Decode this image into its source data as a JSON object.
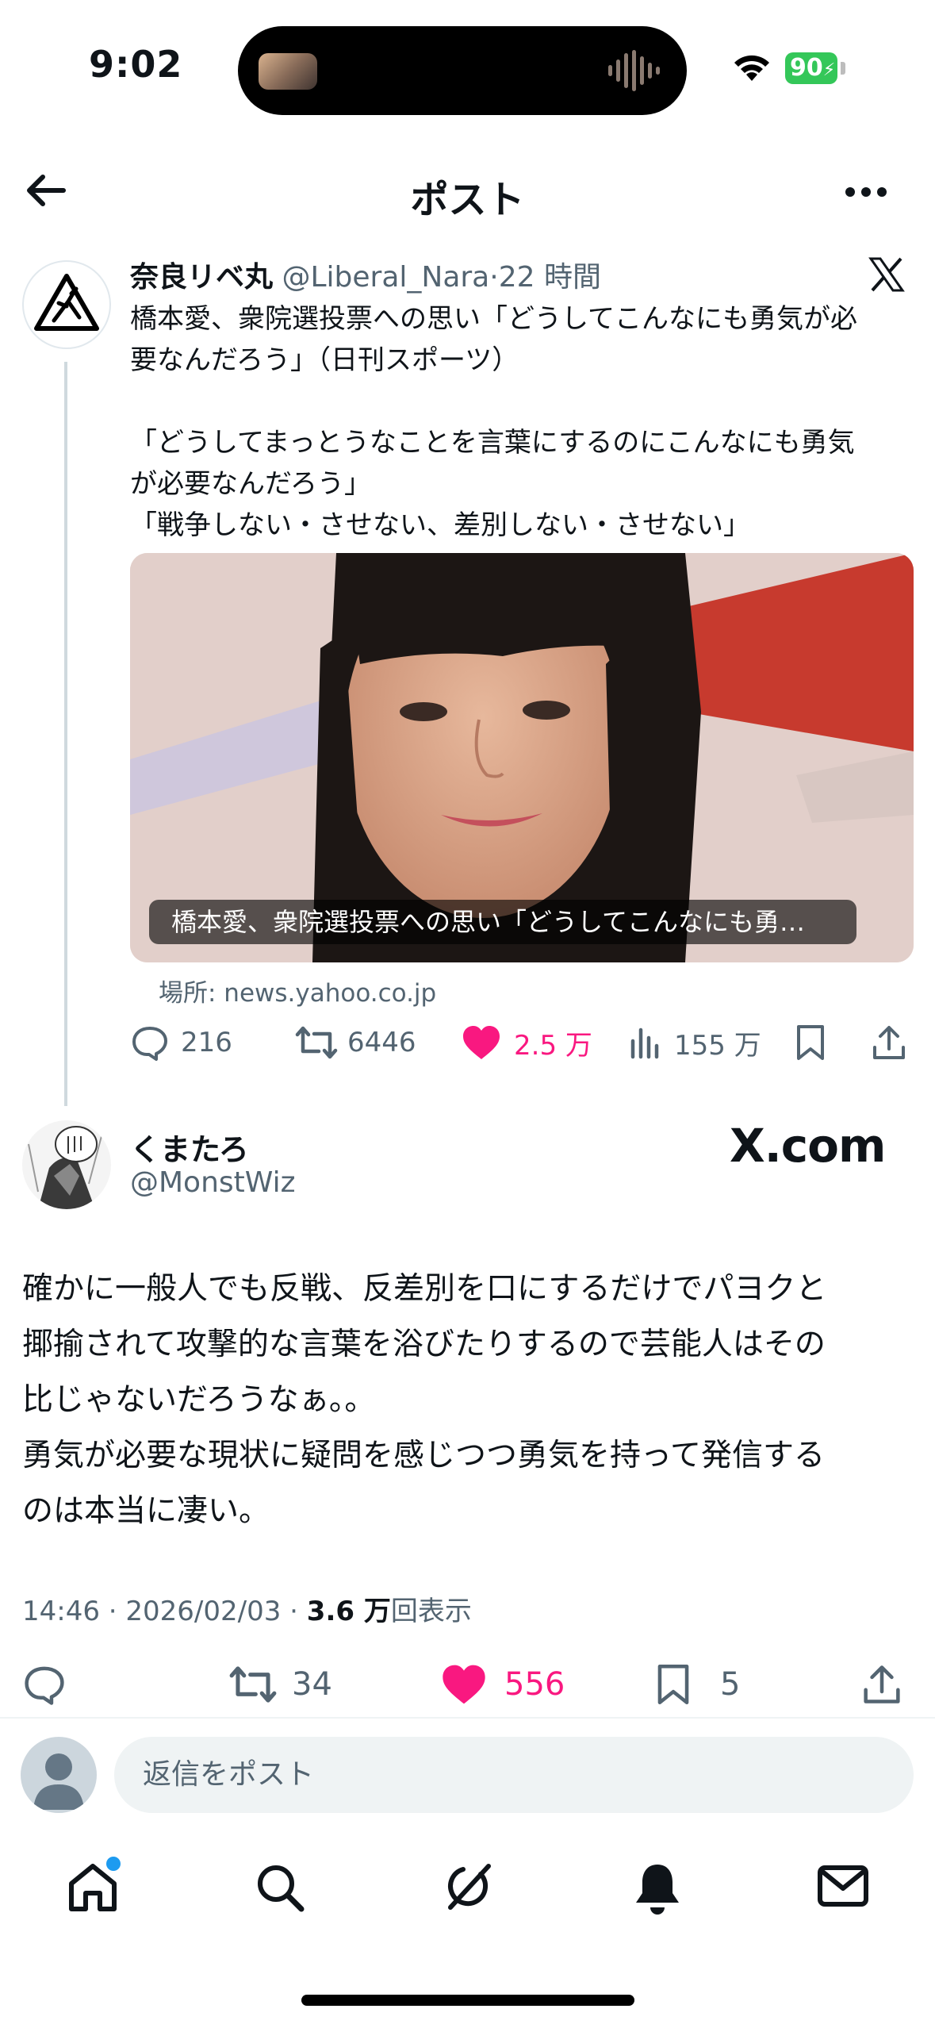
{
  "status_bar": {
    "time": "9:02",
    "battery": "90"
  },
  "header": {
    "title": "ポスト"
  },
  "quoted_post": {
    "name": "奈良リベ丸",
    "handle": "@Liberal_Nara",
    "time": "22 時間",
    "text": "橋本愛、衆院選投票への思い「どうしてこんなにも勇気が必\n要なんだろう」（日刊スポーツ）\n\n「どうしてまっとうなことを言葉にするのにこんなにも勇気\nが必要なんだろう」\n「戦争しない・させない、差別しない・させない」",
    "card_caption": "橋本愛、衆院選投票への思い「どうしてこんなにも勇…",
    "card_source": "場所: news.yahoo.co.jp",
    "replies": "216",
    "reposts": "6446",
    "likes": "2.5 万",
    "views": "155 万"
  },
  "main_post": {
    "name": "くまたろ",
    "handle": "@MonstWiz",
    "watermark": "X.com",
    "text": "確かに一般人でも反戦、反差別を口にするだけでパヨクと\n揶揄されて攻撃的な言葉を浴びたりするので芸能人はその\n比じゃないだろうなぁ。。\n勇気が必要な現状に疑問を感じつつ勇気を持って発信する\nのは本当に凄い。",
    "timestamp": "14:46 · 2026/02/03 · ",
    "view_count": "3.6 万",
    "view_suffix": "回表示",
    "reposts": "34",
    "likes": "556",
    "bookmarks": "5"
  },
  "reply_bar": {
    "placeholder": "返信をポスト"
  },
  "colors": {
    "like_pink": "#f91880",
    "text_gray": "#536471",
    "accent_blue": "#1d9bf0",
    "battery_green": "#34c759"
  },
  "icons": [
    "back-arrow-icon",
    "more-icon",
    "x-logo-icon",
    "reply-icon",
    "repost-icon",
    "like-icon",
    "views-icon",
    "bookmark-icon",
    "share-icon",
    "home-icon",
    "search-icon",
    "grok-icon",
    "notifications-icon",
    "messages-icon"
  ]
}
